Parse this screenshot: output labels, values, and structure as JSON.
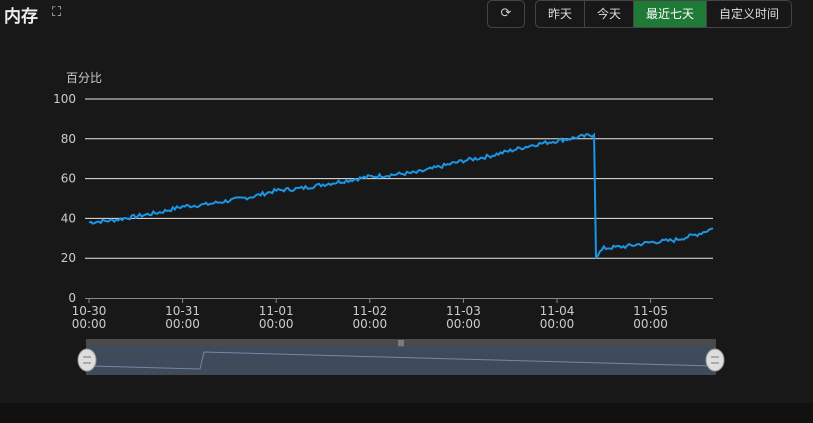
{
  "header": {
    "title": "内存",
    "expand_icon": "expand-icon",
    "refresh_icon": "refresh-icon",
    "ranges": [
      "昨天",
      "今天",
      "最近七天",
      "自定义时间"
    ],
    "active_range": "最近七天"
  },
  "colors": {
    "line": "#1a96e6",
    "active": "#1e7a34"
  },
  "chart_data": {
    "type": "line",
    "ylabel": "百分比",
    "ylim": [
      0,
      100
    ],
    "yticks": [
      0,
      20,
      40,
      60,
      80,
      100
    ],
    "x_unit": "hours since 10-30 00:00",
    "xlim": [
      0,
      160
    ],
    "xticks": [
      {
        "h": 0,
        "d": "10-30",
        "t": "00:00"
      },
      {
        "h": 24,
        "d": "10-31",
        "t": "00:00"
      },
      {
        "h": 48,
        "d": "11-01",
        "t": "00:00"
      },
      {
        "h": 72,
        "d": "11-02",
        "t": "00:00"
      },
      {
        "h": 96,
        "d": "11-03",
        "t": "00:00"
      },
      {
        "h": 120,
        "d": "11-04",
        "t": "00:00"
      },
      {
        "h": 144,
        "d": "11-05",
        "t": "00:00"
      }
    ],
    "series": [
      {
        "name": "内存",
        "points": [
          [
            0,
            38
          ],
          [
            6,
            39
          ],
          [
            12,
            41
          ],
          [
            18,
            43
          ],
          [
            24,
            46
          ],
          [
            30,
            47
          ],
          [
            36,
            49
          ],
          [
            42,
            51
          ],
          [
            48,
            54
          ],
          [
            54,
            55
          ],
          [
            60,
            57
          ],
          [
            66,
            59
          ],
          [
            72,
            61
          ],
          [
            78,
            62
          ],
          [
            84,
            63
          ],
          [
            90,
            66
          ],
          [
            96,
            69
          ],
          [
            102,
            71
          ],
          [
            108,
            74
          ],
          [
            114,
            77
          ],
          [
            120,
            79
          ],
          [
            126,
            81
          ],
          [
            129.5,
            82
          ],
          [
            130,
            21
          ],
          [
            132,
            25
          ],
          [
            138,
            26
          ],
          [
            144,
            28
          ],
          [
            150,
            29
          ],
          [
            156,
            32
          ],
          [
            160,
            35
          ]
        ]
      }
    ],
    "grid": true,
    "datazoom_range": [
      0,
      100
    ]
  }
}
